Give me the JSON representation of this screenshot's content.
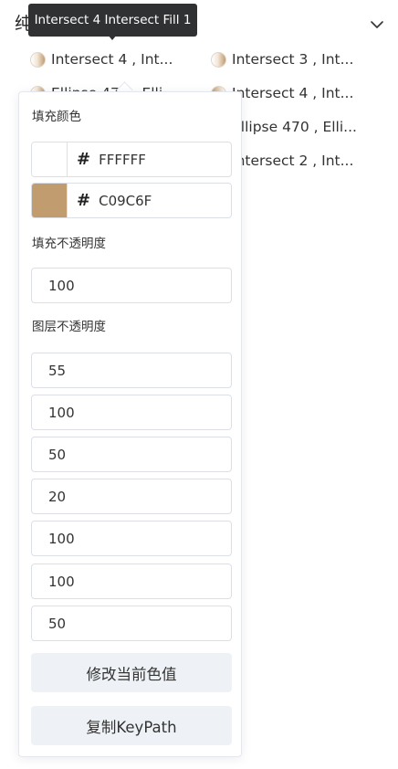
{
  "section": {
    "title": "纯色替换"
  },
  "tooltip": {
    "text": "Intersect 4 Intersect Fill 1"
  },
  "layers": [
    {
      "label": "Intersect 4 , Int...",
      "col": 0,
      "row": 0,
      "dot": "a"
    },
    {
      "label": "Intersect 3 , Int...",
      "col": 1,
      "row": 0,
      "dot": "a"
    },
    {
      "label": "Ellipse 470 , Elli...",
      "col": 0,
      "row": 1,
      "dot": "a"
    },
    {
      "label": "Intersect 4 , Int...",
      "col": 1,
      "row": 1,
      "dot": "b"
    },
    {
      "label": "Ellipse 470 , Elli...",
      "col": 1,
      "row": 2,
      "dot": "a"
    },
    {
      "label": "Intersect 2 , Int...",
      "col": 1,
      "row": 3,
      "dot": "a"
    }
  ],
  "popover": {
    "fill_color_label": "填充颜色",
    "colors": [
      {
        "hash": "#",
        "value": "FFFFFF",
        "swatch": "#FFFFFF"
      },
      {
        "hash": "#",
        "value": "C09C6F",
        "swatch": "#C09C6F"
      }
    ],
    "fill_opacity_label": "填充不透明度",
    "fill_opacity": "100",
    "layer_opacity_label": "图层不透明度",
    "layer_opacities": [
      "55",
      "100",
      "50",
      "20",
      "100",
      "100",
      "50"
    ],
    "modify_button": "修改当前色值",
    "copy_button": "复制KeyPath"
  },
  "colors": {
    "border": "#dcdfe6",
    "button_bg": "#eef2f6",
    "tooltip_bg": "#303133"
  }
}
